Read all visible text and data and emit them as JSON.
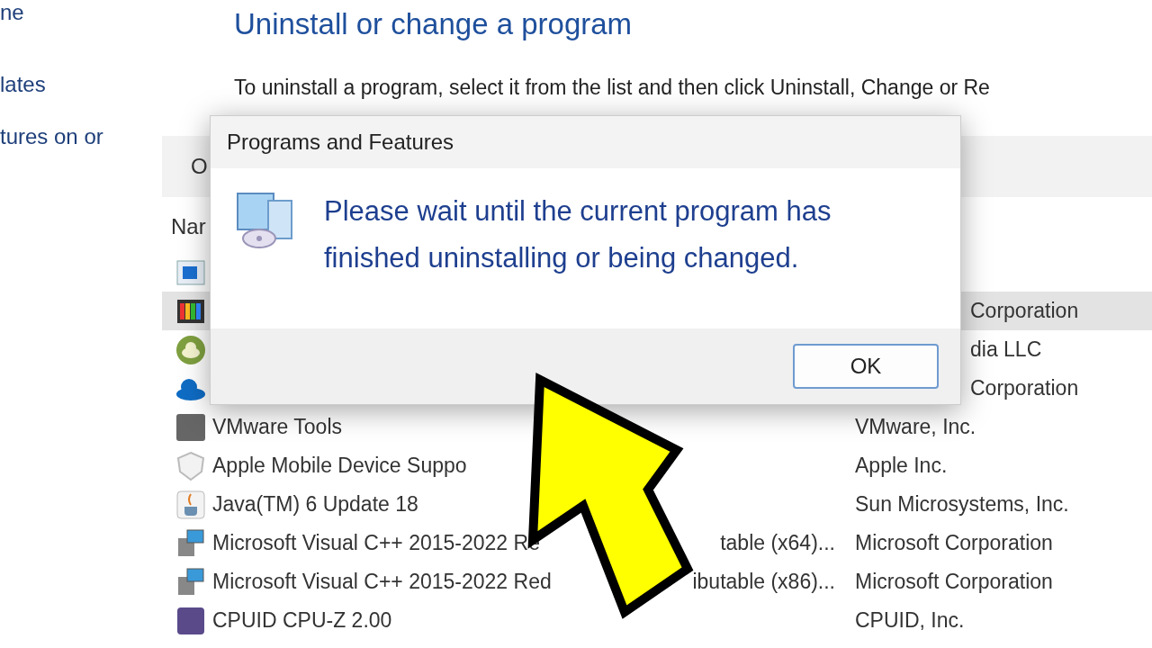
{
  "sidebar": {
    "items": [
      {
        "label": "ne"
      },
      {
        "label": "lates"
      },
      {
        "label": "tures on or"
      }
    ]
  },
  "heading": "Uninstall or change a program",
  "description": "To uninstall a program, select it from the list and then click Uninstall, Change or Re",
  "toolbar": {
    "button": "O"
  },
  "columns": [
    {
      "label": "Nar"
    }
  ],
  "rows": [
    {
      "selected": false
    },
    {
      "covered": true,
      "selected": true,
      "publisher": "Corporation"
    },
    {
      "covered": true,
      "selected": false,
      "publisher": "dia LLC"
    },
    {
      "covered": true,
      "selected": false,
      "publisher": "Corporation"
    },
    {
      "covered": false,
      "selected": false,
      "name": "VMware Tools",
      "publisher": "VMware, Inc."
    },
    {
      "covered": false,
      "selected": false,
      "name": "Apple Mobile Device Suppo",
      "publisher": "Apple Inc."
    },
    {
      "covered": false,
      "selected": false,
      "name": "Java(TM) 6 Update 18",
      "publisher": "Sun Microsystems, Inc."
    },
    {
      "covered": false,
      "selected": false,
      "name": "Microsoft Visual C++ 2015-2022 Re",
      "name_after": "table (x64)...",
      "publisher": "Microsoft Corporation"
    },
    {
      "covered": false,
      "selected": false,
      "name": "Microsoft Visual C++ 2015-2022 Red",
      "name_after": "ibutable (x86)...",
      "publisher": "Microsoft Corporation"
    },
    {
      "covered": false,
      "selected": false,
      "name": "CPUID CPU-Z 2.00",
      "publisher": "CPUID, Inc."
    }
  ],
  "dialog": {
    "title": "Programs and Features",
    "message": "Please wait until the current program has finished uninstalling or being changed.",
    "button": "OK"
  }
}
